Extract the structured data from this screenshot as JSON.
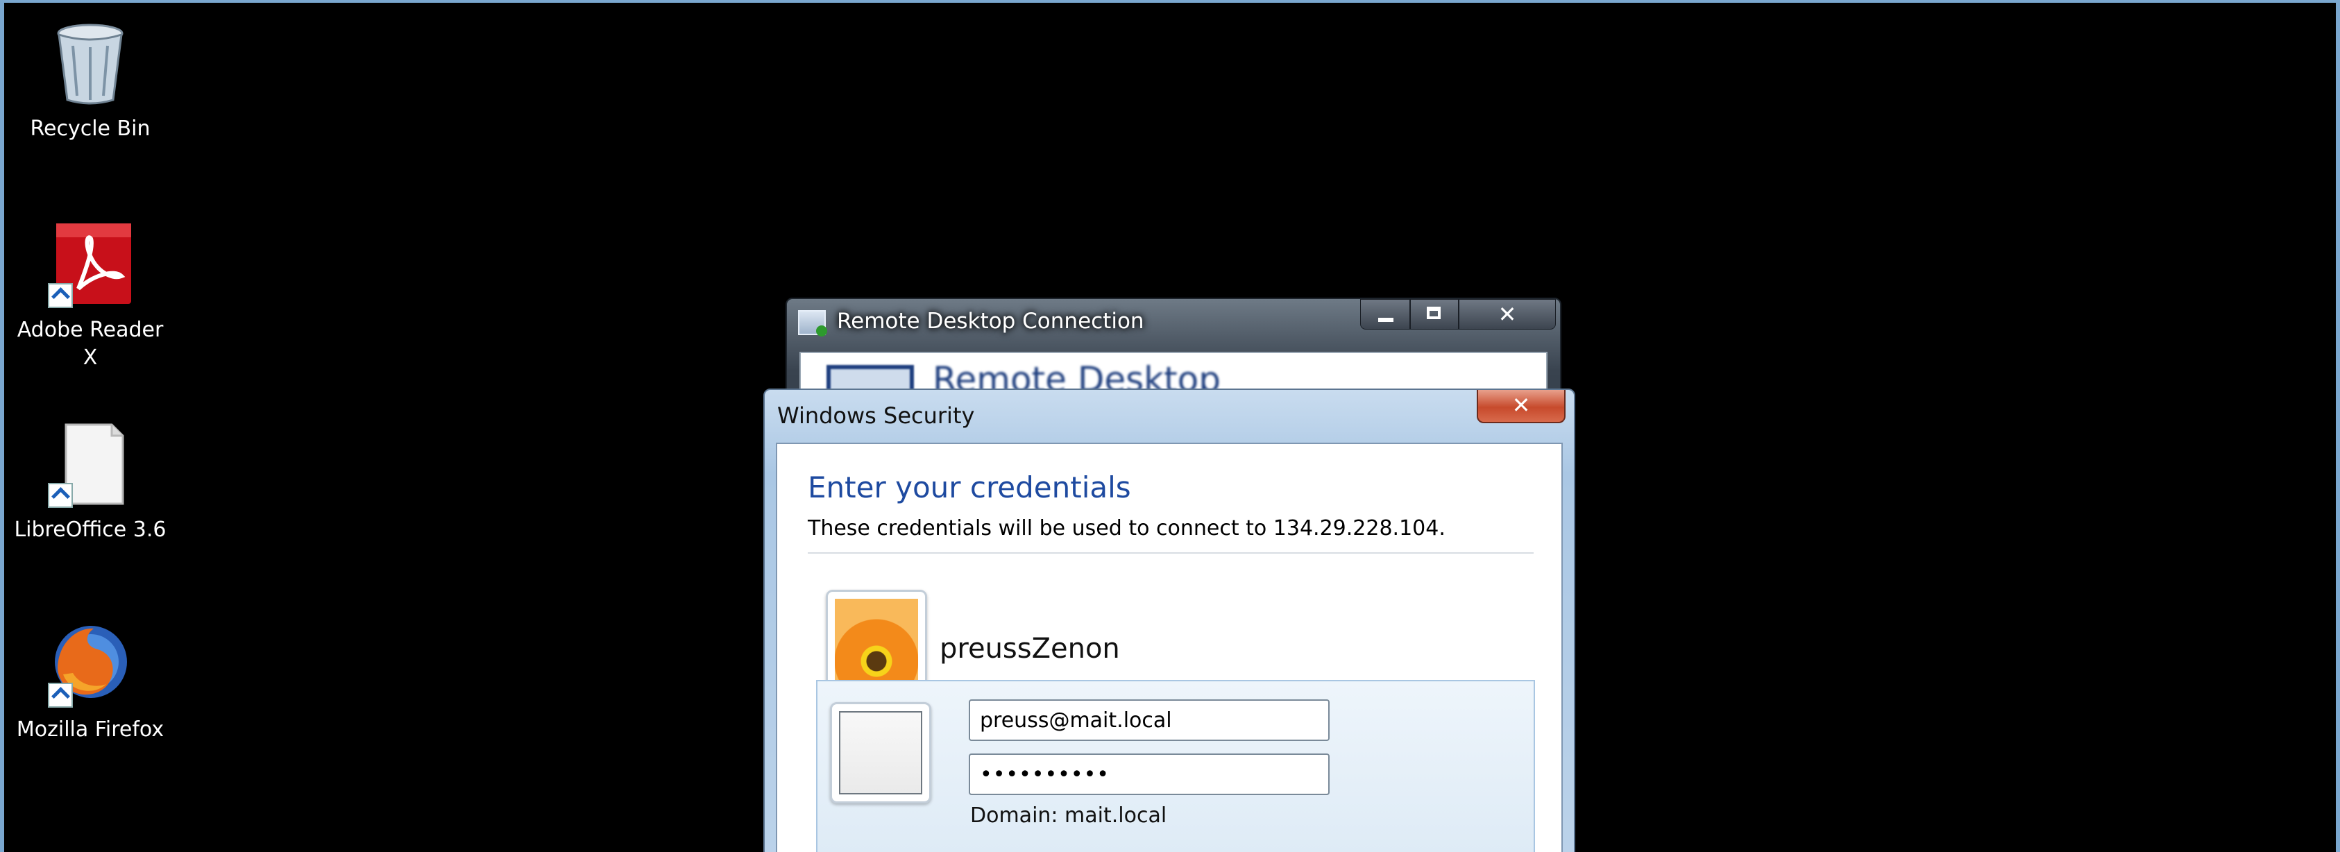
{
  "desktop": {
    "icons": [
      {
        "label": "Recycle Bin",
        "icon": "recycle-bin-icon"
      },
      {
        "label": "Adobe Reader X",
        "icon": "adobe-reader-icon"
      },
      {
        "label": "LibreOffice 3.6",
        "icon": "libreoffice-icon"
      },
      {
        "label": "Mozilla Firefox",
        "icon": "firefox-icon"
      }
    ]
  },
  "rdc_window": {
    "title": "Remote Desktop Connection",
    "banner_text": "Remote Desktop Connection",
    "buttons": {
      "minimize": "minimize",
      "maximize": "maximize",
      "close": "✕"
    }
  },
  "security_dialog": {
    "title": "Windows Security",
    "close": "✕",
    "heading": "Enter your credentials",
    "description": "These credentials will be used to connect to 134.29.228.104.",
    "saved_user": "preussZenon",
    "username_value": "preuss@mait.local",
    "password_value": "••••••••••",
    "domain_text": "Domain: mait.local"
  },
  "colors": {
    "heading_blue": "#1e4aa0",
    "frame_blue": "#7aa7cf",
    "close_red": "#c74a2c"
  }
}
